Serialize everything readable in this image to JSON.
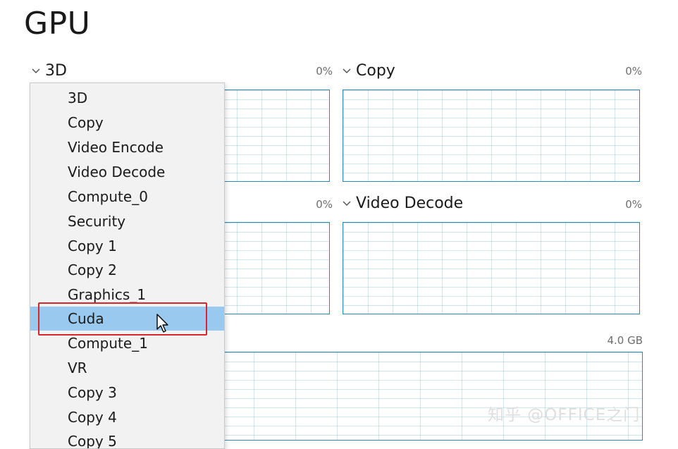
{
  "page": {
    "title": "GPU"
  },
  "engine_selector": {
    "selected": "3D"
  },
  "panes": [
    {
      "title": "",
      "percent": "0%"
    },
    {
      "title": "Copy",
      "percent": "0%"
    },
    {
      "title": "",
      "percent": "0%"
    },
    {
      "title": "Video Decode",
      "percent": "0%"
    }
  ],
  "memory_graph": {
    "capacity": "4.0 GB"
  },
  "dropdown": {
    "items": [
      "3D",
      "Copy",
      "Video Encode",
      "Video Decode",
      "Compute_0",
      "Security",
      "Copy 1",
      "Copy 2",
      "Graphics_1",
      "Cuda",
      "Compute_1",
      "VR",
      "Copy 3",
      "Copy 4",
      "Copy 5"
    ],
    "highlighted": "Cuda"
  },
  "watermark": {
    "text": "知乎 @OFFICE之门"
  },
  "colors": {
    "graph_border": "#2a8bb8",
    "highlight": "#99c9ef",
    "annotation": "#d9262d"
  },
  "icons": [
    "chevron-down-icon",
    "mouse-pointer-icon"
  ]
}
